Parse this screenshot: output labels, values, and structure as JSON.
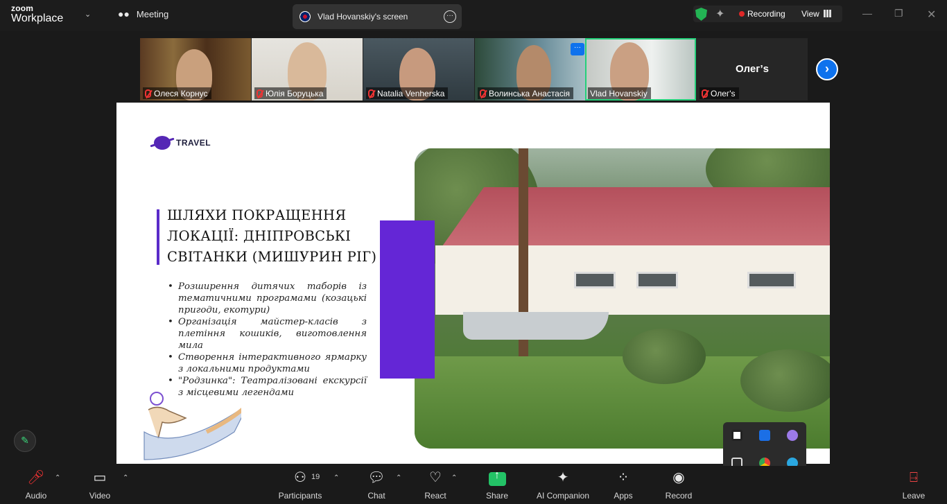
{
  "titlebar": {
    "logo_top": "zoom",
    "logo_bottom": "Workplace",
    "meeting_label": "Meeting",
    "share_tab_label": "Vlad Hovanskiy's screen",
    "recording_label": "Recording",
    "view_label": "View"
  },
  "participants_strip": [
    {
      "name": "Олеся Корнус",
      "muted": true
    },
    {
      "name": "Юлія Боруцька",
      "muted": true
    },
    {
      "name": "Natalia Venherska",
      "muted": true
    },
    {
      "name": "Волинська Анастасія",
      "muted": true
    },
    {
      "name": "Vlad Hovanskiy",
      "muted": false,
      "active_speaker": true
    },
    {
      "name": "Олег's",
      "muted": true,
      "video_off_label": "Олег’s"
    }
  ],
  "slide": {
    "brand": "TRAVEL",
    "heading": "ШЛЯХИ ПОКРАЩЕННЯ ЛОКАЦІЇ: ДНІПРОВСЬКІ СВІТАНКИ (МИШУРИН РІГ)",
    "bullets": [
      "Розширення дитячих таборів із тематичними програмами (козацькі пригоди, екотури)",
      "Організація майстер-класів з плетіння кошиків, виготовлення мила",
      "Створення інтерактивного ярмарку з локальними продуктами",
      "\"Родзинка\": Театралізовані екскурсії з місцевими легендами"
    ],
    "accent_color": "#6426d6"
  },
  "toolbar": {
    "audio": "Audio",
    "video": "Video",
    "participants": "Participants",
    "participants_count": "19",
    "chat": "Chat",
    "react": "React",
    "share": "Share",
    "ai_companion": "AI Companion",
    "apps": "Apps",
    "record": "Record",
    "leave": "Leave"
  },
  "colors": {
    "zoom_blue": "#0e72ed",
    "share_green": "#23c266",
    "recording_red": "#e02828",
    "active_speaker_green": "#24d07a"
  }
}
